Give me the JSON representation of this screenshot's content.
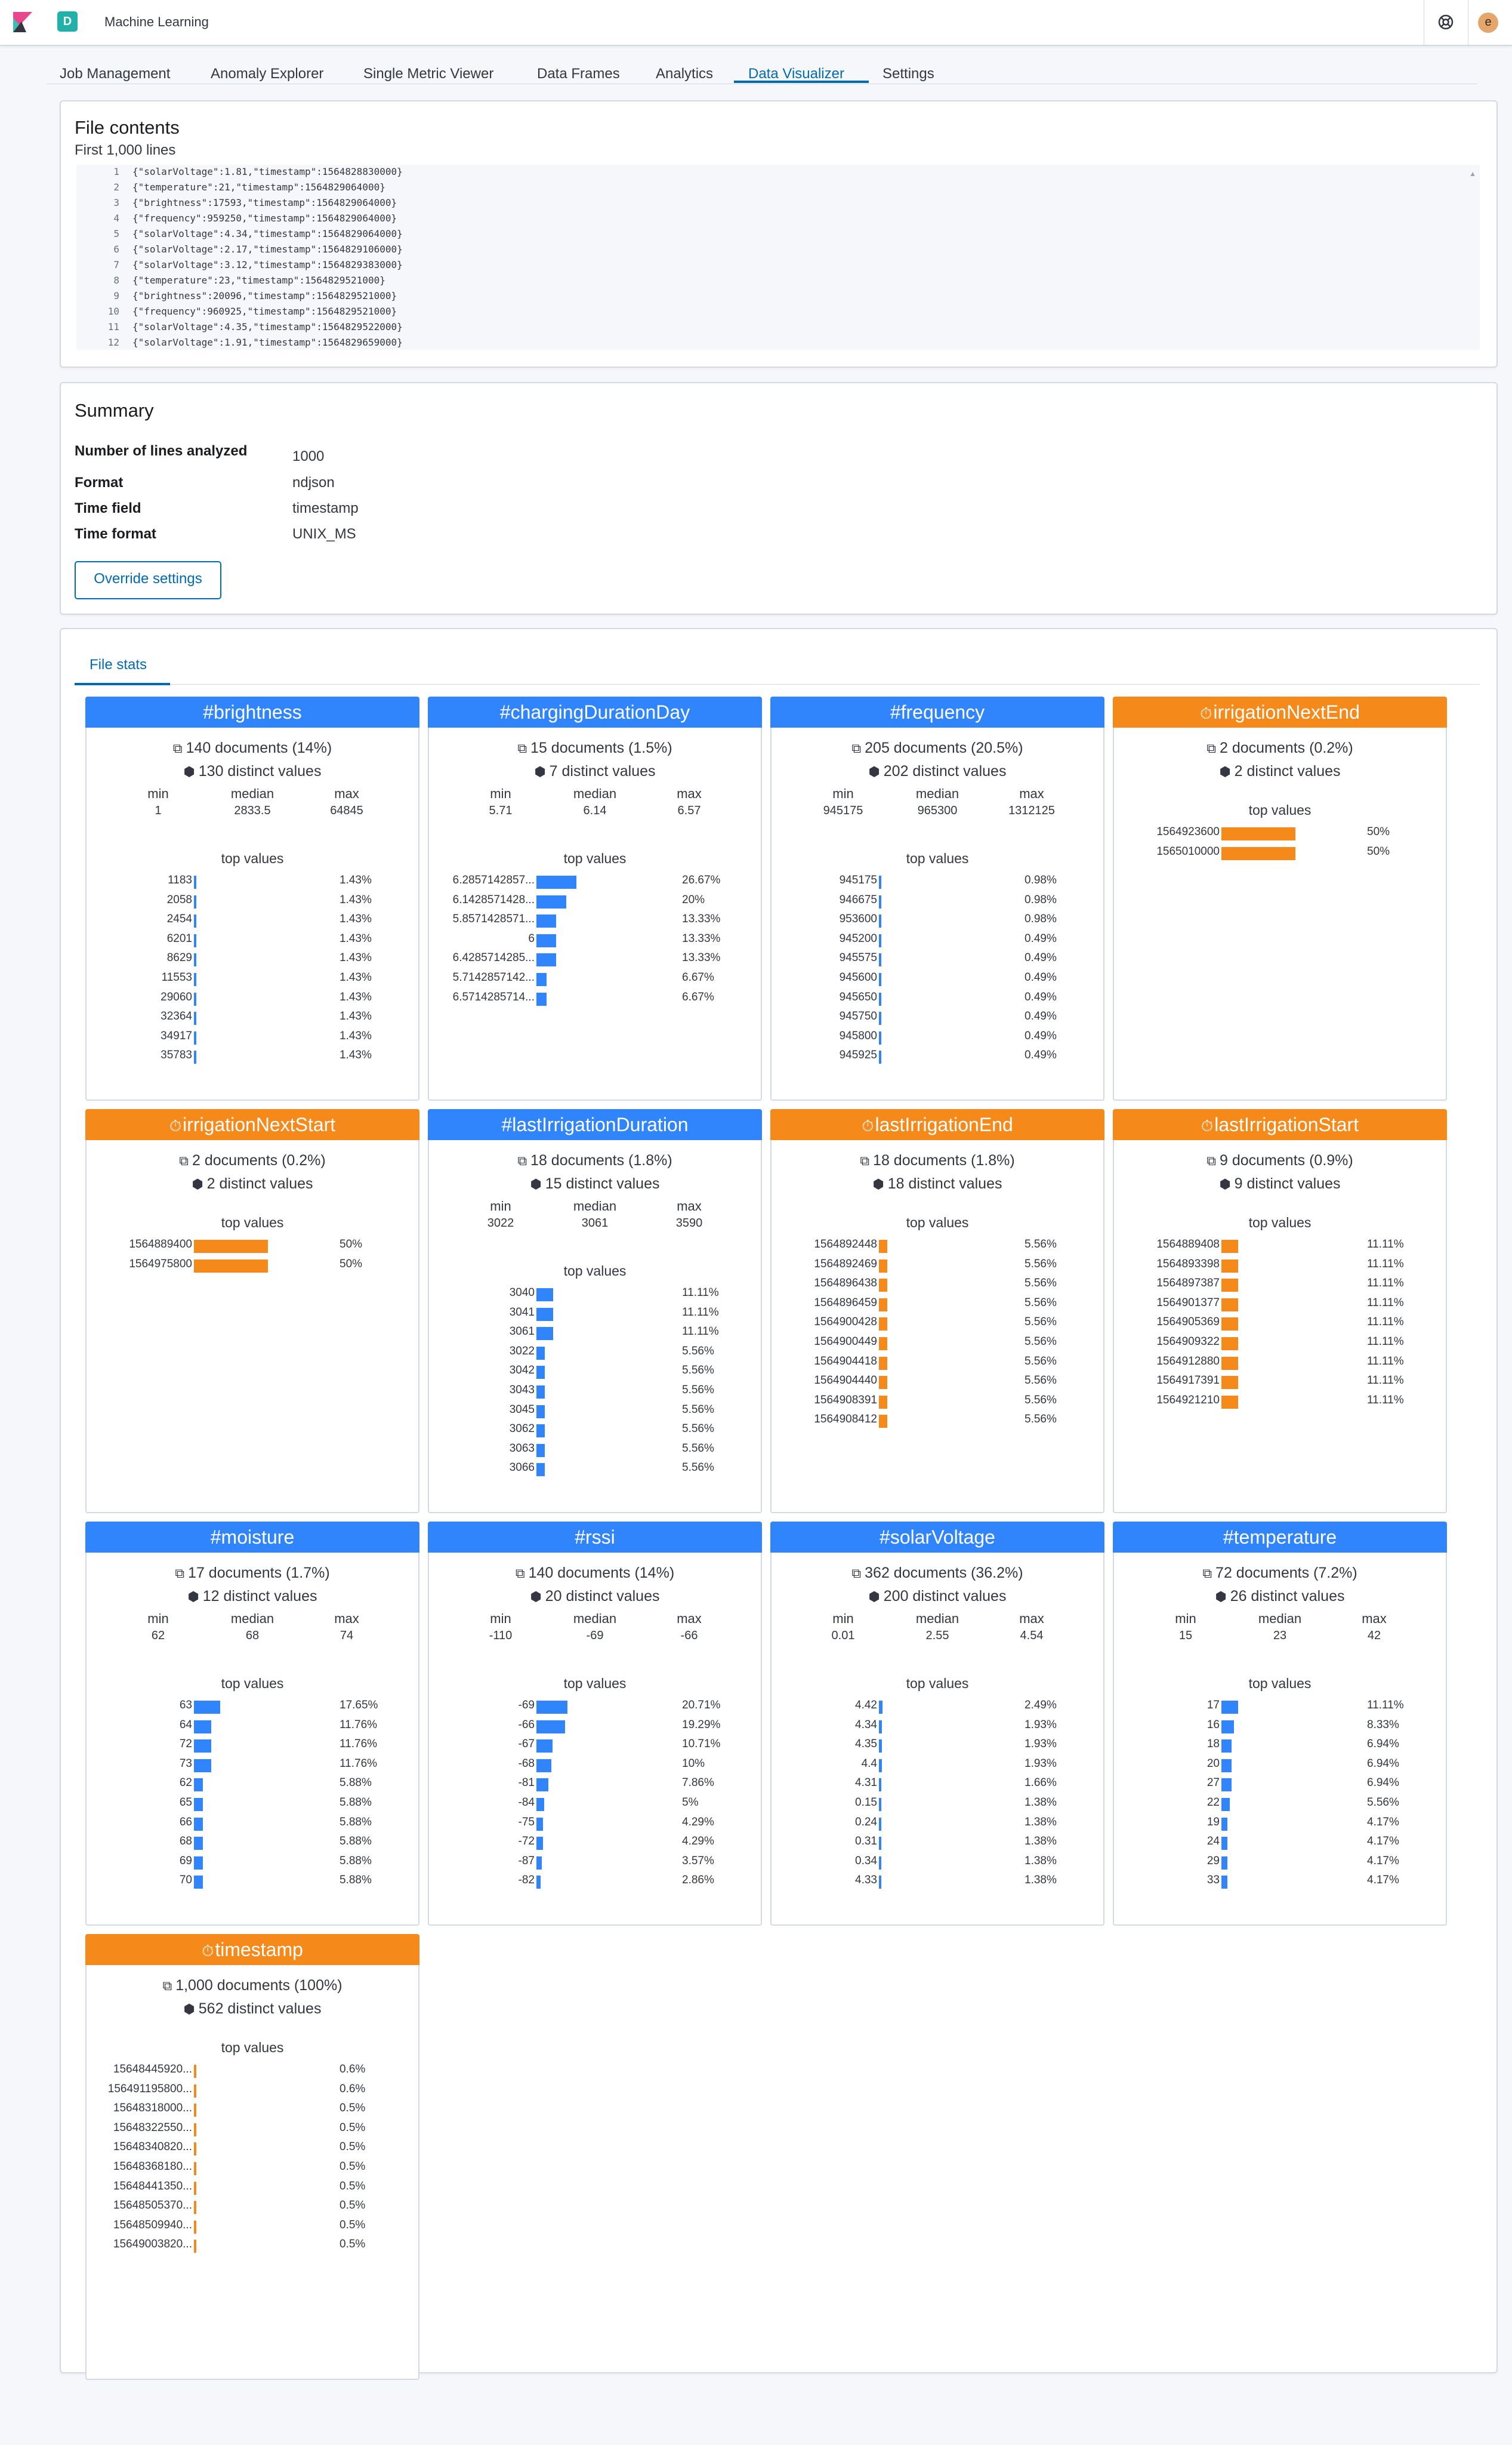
{
  "header": {
    "app_badge": "D",
    "app_title": "Machine Learning",
    "avatar_letter": "e"
  },
  "tabs": [
    {
      "label": "Job Management"
    },
    {
      "label": "Anomaly Explorer"
    },
    {
      "label": "Single Metric Viewer"
    },
    {
      "label": "Data Frames"
    },
    {
      "label": "Analytics"
    },
    {
      "label": "Data Visualizer",
      "active": true
    },
    {
      "label": "Settings"
    }
  ],
  "file_contents": {
    "title": "File contents",
    "subtitle": "First 1,000 lines",
    "lines": [
      "{\"solarVoltage\":1.81,\"timestamp\":1564828830000}",
      "{\"temperature\":21,\"timestamp\":1564829064000}",
      "{\"brightness\":17593,\"timestamp\":1564829064000}",
      "{\"frequency\":959250,\"timestamp\":1564829064000}",
      "{\"solarVoltage\":4.34,\"timestamp\":1564829064000}",
      "{\"solarVoltage\":2.17,\"timestamp\":1564829106000}",
      "{\"solarVoltage\":3.12,\"timestamp\":1564829383000}",
      "{\"temperature\":23,\"timestamp\":1564829521000}",
      "{\"brightness\":20096,\"timestamp\":1564829521000}",
      "{\"frequency\":960925,\"timestamp\":1564829521000}",
      "{\"solarVoltage\":4.35,\"timestamp\":1564829522000}",
      "{\"solarVoltage\":1.91,\"timestamp\":1564829659000}"
    ]
  },
  "summary": {
    "title": "Summary",
    "rows": [
      {
        "label": "Number of lines analyzed",
        "value": "1000"
      },
      {
        "label": "Format",
        "value": "ndjson"
      },
      {
        "label": "Time field",
        "value": "timestamp"
      },
      {
        "label": "Time format",
        "value": "UNIX_MS"
      }
    ],
    "override_label": "Override settings"
  },
  "file_stats": {
    "tab_label": "File stats",
    "colors": {
      "number": "#3185fc",
      "date": "#f5891a"
    },
    "labels": {
      "min": "min",
      "median": "median",
      "max": "max",
      "top_values": "top values"
    },
    "cards": [
      {
        "name": "#brightness",
        "kind": "number",
        "docs": "140 documents (14%)",
        "distinct": "130 distinct values",
        "min": "1",
        "median": "2833.5",
        "max": "64845",
        "top": [
          [
            "1183",
            "1.43%",
            1.43
          ],
          [
            "2058",
            "1.43%",
            1.43
          ],
          [
            "2454",
            "1.43%",
            1.43
          ],
          [
            "6201",
            "1.43%",
            1.43
          ],
          [
            "8629",
            "1.43%",
            1.43
          ],
          [
            "11553",
            "1.43%",
            1.43
          ],
          [
            "29060",
            "1.43%",
            1.43
          ],
          [
            "32364",
            "1.43%",
            1.43
          ],
          [
            "34917",
            "1.43%",
            1.43
          ],
          [
            "35783",
            "1.43%",
            1.43
          ]
        ]
      },
      {
        "name": "#chargingDurationDay",
        "kind": "number",
        "docs": "15 documents (1.5%)",
        "distinct": "7 distinct values",
        "min": "5.71",
        "median": "6.14",
        "max": "6.57",
        "top": [
          [
            "6.2857142857...",
            "26.67%",
            26.67
          ],
          [
            "6.1428571428...",
            "20%",
            20
          ],
          [
            "5.8571428571...",
            "13.33%",
            13.33
          ],
          [
            "6",
            "13.33%",
            13.33
          ],
          [
            "6.4285714285...",
            "13.33%",
            13.33
          ],
          [
            "5.7142857142...",
            "6.67%",
            6.67
          ],
          [
            "6.5714285714...",
            "6.67%",
            6.67
          ]
        ]
      },
      {
        "name": "#frequency",
        "kind": "number",
        "docs": "205 documents (20.5%)",
        "distinct": "202 distinct values",
        "min": "945175",
        "median": "965300",
        "max": "1312125",
        "top": [
          [
            "945175",
            "0.98%",
            0.98
          ],
          [
            "946675",
            "0.98%",
            0.98
          ],
          [
            "953600",
            "0.98%",
            0.98
          ],
          [
            "945200",
            "0.49%",
            0.49
          ],
          [
            "945575",
            "0.49%",
            0.49
          ],
          [
            "945600",
            "0.49%",
            0.49
          ],
          [
            "945650",
            "0.49%",
            0.49
          ],
          [
            "945750",
            "0.49%",
            0.49
          ],
          [
            "945800",
            "0.49%",
            0.49
          ],
          [
            "945925",
            "0.49%",
            0.49
          ]
        ]
      },
      {
        "name": "irrigationNextEnd",
        "kind": "date",
        "docs": "2 documents (0.2%)",
        "distinct": "2 distinct values",
        "top": [
          [
            "1564923600",
            "50%",
            50
          ],
          [
            "1565010000",
            "50%",
            50
          ]
        ]
      },
      {
        "name": "irrigationNextStart",
        "kind": "date",
        "docs": "2 documents (0.2%)",
        "distinct": "2 distinct values",
        "top": [
          [
            "1564889400",
            "50%",
            50
          ],
          [
            "1564975800",
            "50%",
            50
          ]
        ]
      },
      {
        "name": "#lastIrrigationDuration",
        "kind": "number",
        "docs": "18 documents (1.8%)",
        "distinct": "15 distinct values",
        "min": "3022",
        "median": "3061",
        "max": "3590",
        "top": [
          [
            "3040",
            "11.11%",
            11.11
          ],
          [
            "3041",
            "11.11%",
            11.11
          ],
          [
            "3061",
            "11.11%",
            11.11
          ],
          [
            "3022",
            "5.56%",
            5.56
          ],
          [
            "3042",
            "5.56%",
            5.56
          ],
          [
            "3043",
            "5.56%",
            5.56
          ],
          [
            "3045",
            "5.56%",
            5.56
          ],
          [
            "3062",
            "5.56%",
            5.56
          ],
          [
            "3063",
            "5.56%",
            5.56
          ],
          [
            "3066",
            "5.56%",
            5.56
          ]
        ]
      },
      {
        "name": "lastIrrigationEnd",
        "kind": "date",
        "docs": "18 documents (1.8%)",
        "distinct": "18 distinct values",
        "top": [
          [
            "1564892448",
            "5.56%",
            5.56
          ],
          [
            "1564892469",
            "5.56%",
            5.56
          ],
          [
            "1564896438",
            "5.56%",
            5.56
          ],
          [
            "1564896459",
            "5.56%",
            5.56
          ],
          [
            "1564900428",
            "5.56%",
            5.56
          ],
          [
            "1564900449",
            "5.56%",
            5.56
          ],
          [
            "1564904418",
            "5.56%",
            5.56
          ],
          [
            "1564904440",
            "5.56%",
            5.56
          ],
          [
            "1564908391",
            "5.56%",
            5.56
          ],
          [
            "1564908412",
            "5.56%",
            5.56
          ]
        ]
      },
      {
        "name": "lastIrrigationStart",
        "kind": "date",
        "docs": "9 documents (0.9%)",
        "distinct": "9 distinct values",
        "top": [
          [
            "1564889408",
            "11.11%",
            11.11
          ],
          [
            "1564893398",
            "11.11%",
            11.11
          ],
          [
            "1564897387",
            "11.11%",
            11.11
          ],
          [
            "1564901377",
            "11.11%",
            11.11
          ],
          [
            "1564905369",
            "11.11%",
            11.11
          ],
          [
            "1564909322",
            "11.11%",
            11.11
          ],
          [
            "1564912880",
            "11.11%",
            11.11
          ],
          [
            "1564917391",
            "11.11%",
            11.11
          ],
          [
            "1564921210",
            "11.11%",
            11.11
          ]
        ]
      },
      {
        "name": "#moisture",
        "kind": "number",
        "docs": "17 documents (1.7%)",
        "distinct": "12 distinct values",
        "min": "62",
        "median": "68",
        "max": "74",
        "top": [
          [
            "63",
            "17.65%",
            17.65
          ],
          [
            "64",
            "11.76%",
            11.76
          ],
          [
            "72",
            "11.76%",
            11.76
          ],
          [
            "73",
            "11.76%",
            11.76
          ],
          [
            "62",
            "5.88%",
            5.88
          ],
          [
            "65",
            "5.88%",
            5.88
          ],
          [
            "66",
            "5.88%",
            5.88
          ],
          [
            "68",
            "5.88%",
            5.88
          ],
          [
            "69",
            "5.88%",
            5.88
          ],
          [
            "70",
            "5.88%",
            5.88
          ]
        ]
      },
      {
        "name": "#rssi",
        "kind": "number",
        "docs": "140 documents (14%)",
        "distinct": "20 distinct values",
        "min": "-110",
        "median": "-69",
        "max": "-66",
        "top": [
          [
            "-69",
            "20.71%",
            20.71
          ],
          [
            "-66",
            "19.29%",
            19.29
          ],
          [
            "-67",
            "10.71%",
            10.71
          ],
          [
            "-68",
            "10%",
            10
          ],
          [
            "-81",
            "7.86%",
            7.86
          ],
          [
            "-84",
            "5%",
            5
          ],
          [
            "-75",
            "4.29%",
            4.29
          ],
          [
            "-72",
            "4.29%",
            4.29
          ],
          [
            "-87",
            "3.57%",
            3.57
          ],
          [
            "-82",
            "2.86%",
            2.86
          ]
        ]
      },
      {
        "name": "#solarVoltage",
        "kind": "number",
        "docs": "362 documents (36.2%)",
        "distinct": "200 distinct values",
        "min": "0.01",
        "median": "2.55",
        "max": "4.54",
        "top": [
          [
            "4.42",
            "2.49%",
            2.49
          ],
          [
            "4.34",
            "1.93%",
            1.93
          ],
          [
            "4.35",
            "1.93%",
            1.93
          ],
          [
            "4.4",
            "1.93%",
            1.93
          ],
          [
            "4.31",
            "1.66%",
            1.66
          ],
          [
            "0.15",
            "1.38%",
            1.38
          ],
          [
            "0.24",
            "1.38%",
            1.38
          ],
          [
            "0.31",
            "1.38%",
            1.38
          ],
          [
            "0.34",
            "1.38%",
            1.38
          ],
          [
            "4.33",
            "1.38%",
            1.38
          ]
        ]
      },
      {
        "name": "#temperature",
        "kind": "number",
        "docs": "72 documents (7.2%)",
        "distinct": "26 distinct values",
        "min": "15",
        "median": "23",
        "max": "42",
        "top": [
          [
            "17",
            "11.11%",
            11.11
          ],
          [
            "16",
            "8.33%",
            8.33
          ],
          [
            "18",
            "6.94%",
            6.94
          ],
          [
            "20",
            "6.94%",
            6.94
          ],
          [
            "27",
            "6.94%",
            6.94
          ],
          [
            "22",
            "5.56%",
            5.56
          ],
          [
            "19",
            "4.17%",
            4.17
          ],
          [
            "24",
            "4.17%",
            4.17
          ],
          [
            "29",
            "4.17%",
            4.17
          ],
          [
            "33",
            "4.17%",
            4.17
          ]
        ]
      },
      {
        "name": "timestamp",
        "kind": "date",
        "docs": "1,000 documents (100%)",
        "distinct": "562 distinct values",
        "top": [
          [
            "15648445920...",
            "0.6%",
            0.6
          ],
          [
            "156491195800...",
            "0.6%",
            0.6
          ],
          [
            "15648318000...",
            "0.5%",
            0.5
          ],
          [
            "15648322550...",
            "0.5%",
            0.5
          ],
          [
            "15648340820...",
            "0.5%",
            0.5
          ],
          [
            "15648368180...",
            "0.5%",
            0.5
          ],
          [
            "15648441350...",
            "0.5%",
            0.5
          ],
          [
            "15648505370...",
            "0.5%",
            0.5
          ],
          [
            "15648509940...",
            "0.5%",
            0.5
          ],
          [
            "15649003820...",
            "0.5%",
            0.5
          ]
        ]
      }
    ]
  }
}
